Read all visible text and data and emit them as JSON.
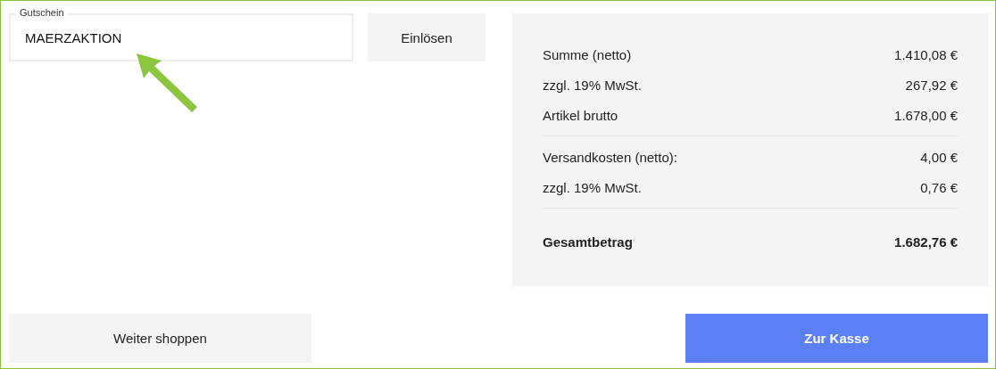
{
  "coupon": {
    "label": "Gutschein",
    "value": "MAERZAKTION"
  },
  "redeem_button": "Einlösen",
  "summary": {
    "groups": [
      {
        "rows": [
          {
            "label": "Summe (netto)",
            "amount": "1.410,08 €"
          },
          {
            "label": "zzgl. 19% MwSt.",
            "amount": "267,92 €"
          },
          {
            "label": "Artikel brutto",
            "amount": "1.678,00 €"
          }
        ]
      },
      {
        "rows": [
          {
            "label": "Versandkosten (netto):",
            "amount": "4,00 €"
          },
          {
            "label": "zzgl. 19% MwSt.",
            "amount": "0,76 €"
          }
        ]
      }
    ],
    "total": {
      "label": "Gesamtbetrag",
      "amount": "1.682,76 €"
    }
  },
  "continue_button": "Weiter shoppen",
  "checkout_button": "Zur Kasse"
}
